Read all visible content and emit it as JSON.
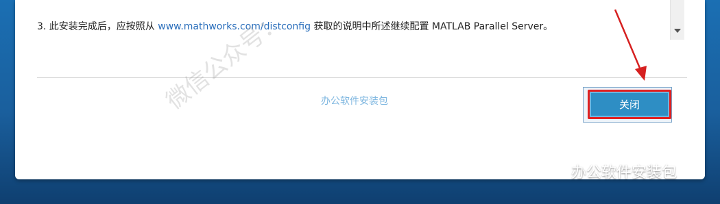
{
  "dialog": {
    "step_prefix": "3. 此安装完成后，应按照从 ",
    "step_link": "www.mathworks.com/distconfig",
    "step_suffix": " 获取的说明中所述继续配置 MATLAB Parallel Server。",
    "footer_link": "办公软件安装包",
    "close_label": "关闭"
  },
  "watermark": {
    "text": "微信公众号："
  },
  "brand": {
    "label": "办公软件安装包",
    "icon": "wechat-icon"
  },
  "colors": {
    "accent": "#2e8ec4",
    "highlight": "#e02020",
    "link": "#2a6ebb",
    "footer_link": "#7fb7e0",
    "background": "#1a5f9d"
  }
}
